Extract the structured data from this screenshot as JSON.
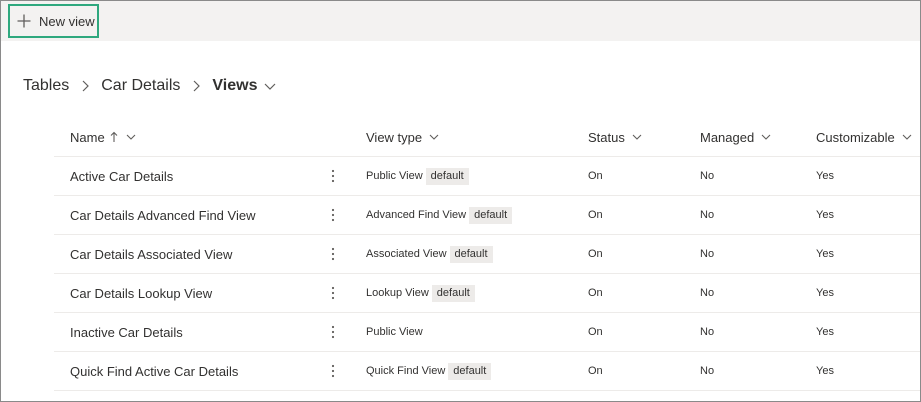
{
  "commandbar": {
    "new_view_label": "New view",
    "new_view_icon": "plus-icon",
    "highlight_color": "#2ea87e"
  },
  "breadcrumb": {
    "items": [
      "Tables",
      "Car Details"
    ],
    "current": "Views"
  },
  "grid": {
    "columns": {
      "name": "Name",
      "view_type": "View type",
      "status": "Status",
      "managed": "Managed",
      "customizable": "Customizable"
    },
    "sort": "ascending",
    "rows": [
      {
        "name": "Active Car Details",
        "view_type": "Public View",
        "badge": "default",
        "status": "On",
        "managed": "No",
        "customizable": "Yes"
      },
      {
        "name": "Car Details Advanced Find View",
        "view_type": "Advanced Find View",
        "badge": "default",
        "status": "On",
        "managed": "No",
        "customizable": "Yes"
      },
      {
        "name": "Car Details Associated View",
        "view_type": "Associated View",
        "badge": "default",
        "status": "On",
        "managed": "No",
        "customizable": "Yes"
      },
      {
        "name": "Car Details Lookup View",
        "view_type": "Lookup View",
        "badge": "default",
        "status": "On",
        "managed": "No",
        "customizable": "Yes"
      },
      {
        "name": "Inactive Car Details",
        "view_type": "Public View",
        "badge": "",
        "status": "On",
        "managed": "No",
        "customizable": "Yes"
      },
      {
        "name": "Quick Find Active Car Details",
        "view_type": "Quick Find View",
        "badge": "default",
        "status": "On",
        "managed": "No",
        "customizable": "Yes"
      }
    ]
  }
}
